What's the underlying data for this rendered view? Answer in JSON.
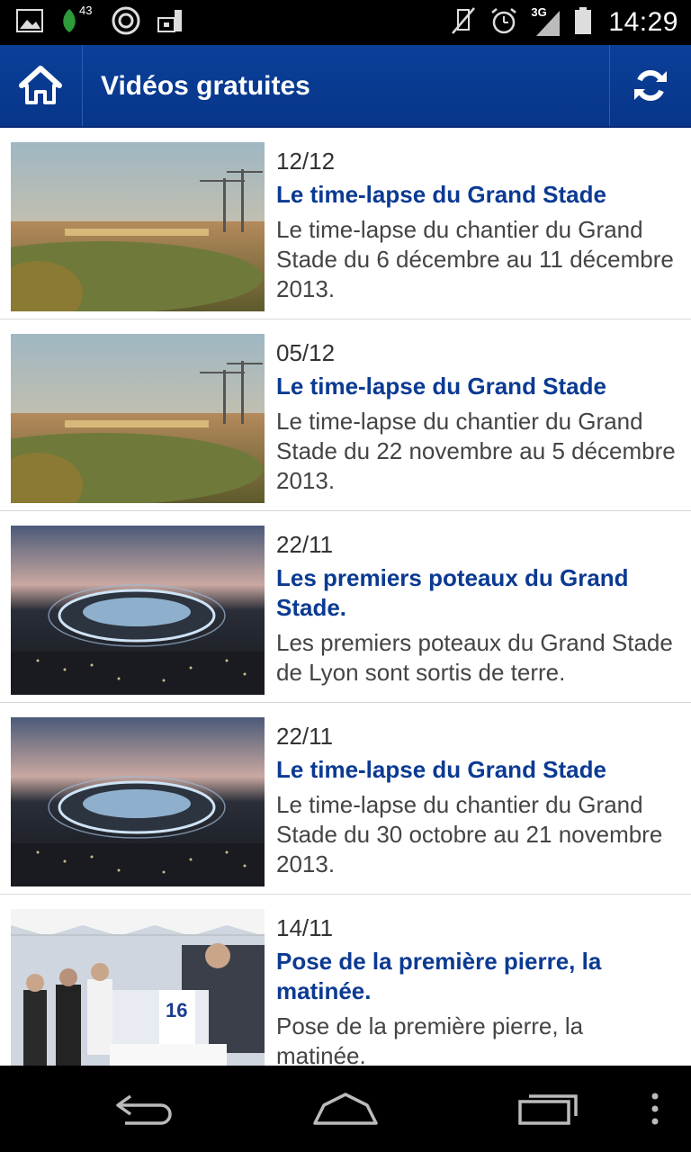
{
  "status_bar": {
    "notification_count": "43",
    "network": "3G",
    "time": "14:29"
  },
  "app_bar": {
    "title": "Vidéos gratuites",
    "home_icon": "home-icon",
    "refresh_icon": "refresh-icon"
  },
  "videos": [
    {
      "date": "12/12",
      "title": "Le time-lapse du Grand Stade",
      "description": "Le time-lapse du chantier du Grand Stade du 6 décembre au 11 décembre 2013.",
      "thumb": "construction-site-sunset"
    },
    {
      "date": "05/12",
      "title": "Le time-lapse du Grand Stade",
      "description": "Le time-lapse du chantier du Grand Stade du 22 novembre au 5 décembre 2013.",
      "thumb": "construction-site-sunset"
    },
    {
      "date": "22/11",
      "title": "Les premiers poteaux du Grand Stade.",
      "description": "Les premiers poteaux du Grand Stade de Lyon sont sortis de terre.",
      "thumb": "stadium-night-render"
    },
    {
      "date": "22/11",
      "title": "Le time-lapse du Grand Stade",
      "description": "Le time-lapse du chantier du Grand Stade du 30 octobre au 21 novembre 2013.",
      "thumb": "stadium-night-render"
    },
    {
      "date": "14/11",
      "title": "Pose de la première pierre, la matinée.",
      "description": "Pose de la première pierre, la matinée.",
      "thumb": "ceremony-tent"
    }
  ],
  "colors": {
    "app_bar": "#0a3f99",
    "title_link": "#0b3a92"
  }
}
